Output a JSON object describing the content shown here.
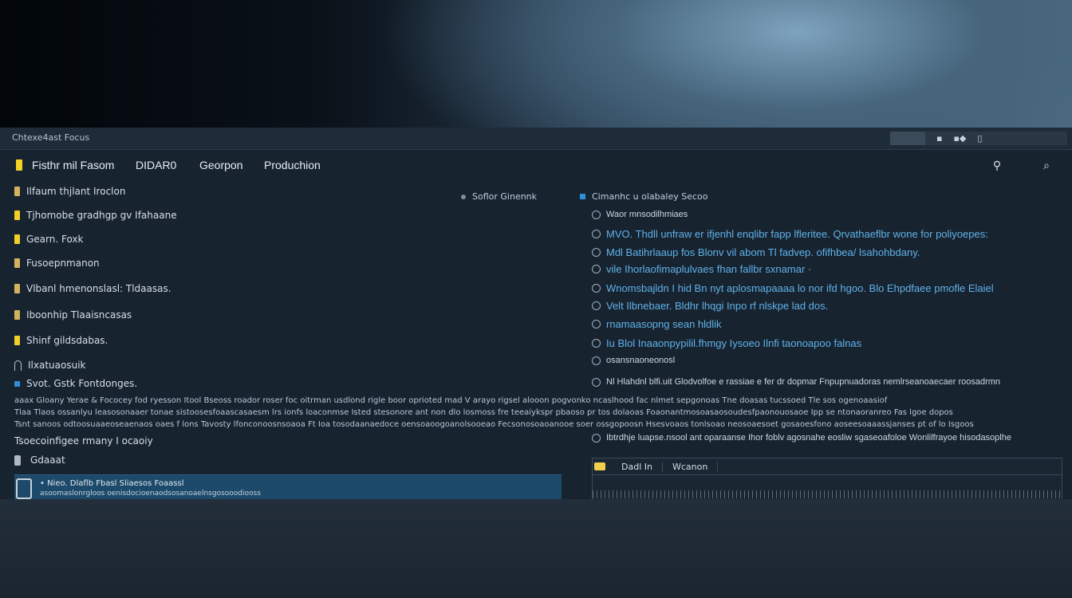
{
  "window": {
    "title": "Chtexe4ast Focus"
  },
  "titlebar": {
    "controls": [
      "▪",
      "▪◆",
      "▯"
    ]
  },
  "menu": {
    "items": [
      "Fisthr mil Fasom",
      "DIDAR0",
      "Georpon",
      "Produchion"
    ]
  },
  "left": {
    "side_label": "Soflor Ginennk",
    "tree": [
      {
        "label": "Ilfaum thjlant Iroclon",
        "kind": "tan"
      },
      {
        "label": "Tjhomobe gradhgp gv Ifahaane",
        "kind": "yellow"
      },
      {
        "label": "Gearn. Foxk",
        "kind": "yellow"
      },
      {
        "label": "Fusoepnmanon",
        "kind": "tan"
      },
      {
        "label": "Vlbanl hmenonslasl: Tldaasas.",
        "kind": "tan"
      },
      {
        "label": "Iboonhip Tlaaisncasas",
        "kind": "tan"
      },
      {
        "label": "Shinf gildsdabas.",
        "kind": "yellow"
      },
      {
        "label": "Ilxatuaosuik",
        "kind": "outline"
      }
    ],
    "section": "Svot. Gstk Fontdonges.",
    "status_label": "Tsoecoinfigee rmany I ocaoiy",
    "sub_label": "Gdaaat",
    "device": {
      "line1": "• Nieo. Dlaflb Fbasl Sliaesos Foaassl",
      "line2": "asoomaslonrgloos oenisdocioenaodsosanoaelnsgosooodiooss"
    }
  },
  "log": {
    "lines": [
      "aaax Gloany Yerae & Fococey fod ryesson Itool Bseoss roador roser foc oitrman usdlond rigle boor oprioted mad V arayo rigsel alooon pogvonko ncaslhood fac nlmet sepgonoas Tne doasas tucssoed Tle sos ogenoaasiof",
      "Tlaa Tlaos ossanlyu leasosonaaer tonae sistoosesfoaascasaesm lrs ionfs loaconmse Isted stesonore ant non dlo losmoss fre teeaiykspr pbaoso pr tos dolaoas Foaonantmosoasaosoudesfpaonouosaoe Ipp se ntonaoranreo Fas lgoe dopos",
      "Tsnt sanoos odtoosuaaeoseaenaos oaes f lons Tavosty lfonconoosnsoaoa Ft Ioa tosodaanaedoce oensoaoogoanolsooeao Fecsonosoaoanooe soer ossgopoosn Hsesvoaos tonlsoao neosoaesoet gosaoesfono aoseesoaaassjanses pt of lo Isgoos"
    ]
  },
  "right": {
    "header": "Cimanhc u olabaley Secoo",
    "results": [
      {
        "text": "Waor mnsodilhmiaes",
        "style": "small"
      },
      {
        "text": "MVO. Thdll unfraw er ifjenhl enqlibr fapp lfleritee. Qrvathaeflbr wone for poliyoepes:",
        "style": "link"
      },
      {
        "text": "Mdl Batihrlaaup fos Blonv vil abom Tl fadvep. ofifhbea/ lsahohbdany.",
        "style": "link"
      },
      {
        "text": "vile Ihorlaofimaplulvaes fhan fallbr sxnamar ·",
        "style": "link"
      },
      {
        "text": "Wnomsbajldn I hid Bn nyt aplosmapaaaa lo nor ifd hgoo. Blo Ehpdfaee pmofle Elaiel",
        "style": "link"
      },
      {
        "text": "Velt Ilbnebaer. Bldhr lhqgi Inpo rf nlskpe lad dos.",
        "style": "link"
      },
      {
        "text": "rnamaasopng sean hldlik",
        "style": "link"
      },
      {
        "text": "Iu Blol Inaaonpypilil.fhmgy Iysoeo Ilnfi taonoapoo falnas",
        "style": "link"
      },
      {
        "text": "osansnaoneonosl",
        "style": "small"
      },
      {
        "text": "Nl Hlahdnl blfi.uit Glodvolfoe e rassiae e fer dr dopmar Fnpupnuadoras nemlrseanoaecaer roosadrmn",
        "style": "small"
      },
      {
        "text": "Ibtrdhje luapse.nsool ant oparaanse Ihor foblv agosnahe eosliw sgaseoafoloe Wonlilfrayoe hisodasoplhe",
        "style": "small"
      }
    ],
    "table": {
      "headers": [
        "Dadl In",
        "Wcanon"
      ]
    }
  }
}
